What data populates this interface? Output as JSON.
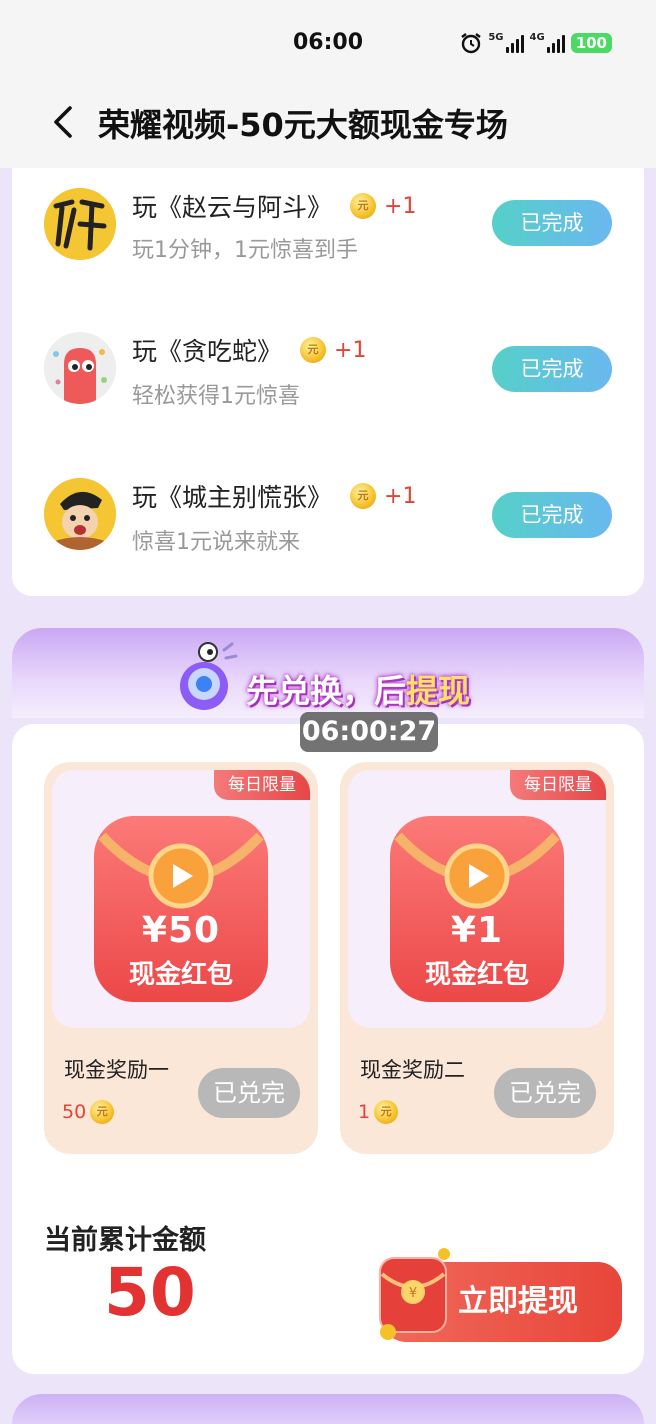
{
  "status": {
    "time": "06:00",
    "network_1": "5G",
    "network_2": "4G",
    "battery": "100"
  },
  "nav": {
    "title": "荣耀视频-50元大额现金专场"
  },
  "tasks": [
    {
      "title": "玩《赵云与阿斗》",
      "coin_glyph": "元",
      "reward": "+1",
      "subtitle": "玩1分钟，1元惊喜到手",
      "status": "已完成"
    },
    {
      "title": "玩《贪吃蛇》",
      "coin_glyph": "元",
      "reward": "+1",
      "subtitle": "轻松获得1元惊喜",
      "status": "已完成"
    },
    {
      "title": "玩《城主别慌张》",
      "coin_glyph": "元",
      "reward": "+1",
      "subtitle": "惊喜1元说来就来",
      "status": "已完成"
    }
  ],
  "banner": {
    "text_1": "先兑换，后",
    "text_2": "提现"
  },
  "timer": "06:00:27",
  "rewards": [
    {
      "tag": "每日限量",
      "amount": "¥50",
      "label": "现金红包",
      "name": "现金奖励一",
      "cost": "50",
      "coin_glyph": "元",
      "button": "已兑完"
    },
    {
      "tag": "每日限量",
      "amount": "¥1",
      "label": "现金红包",
      "name": "现金奖励二",
      "cost": "1",
      "coin_glyph": "元",
      "button": "已兑完"
    }
  ],
  "total": {
    "label": "当前累计金额",
    "value": "50"
  },
  "withdraw": {
    "label": "立即提现"
  },
  "colors": {
    "accent_red": "#e23232",
    "done_gradient_start": "#55d0c8",
    "done_gradient_end": "#6ab8f0",
    "background": "#ece4f8"
  }
}
